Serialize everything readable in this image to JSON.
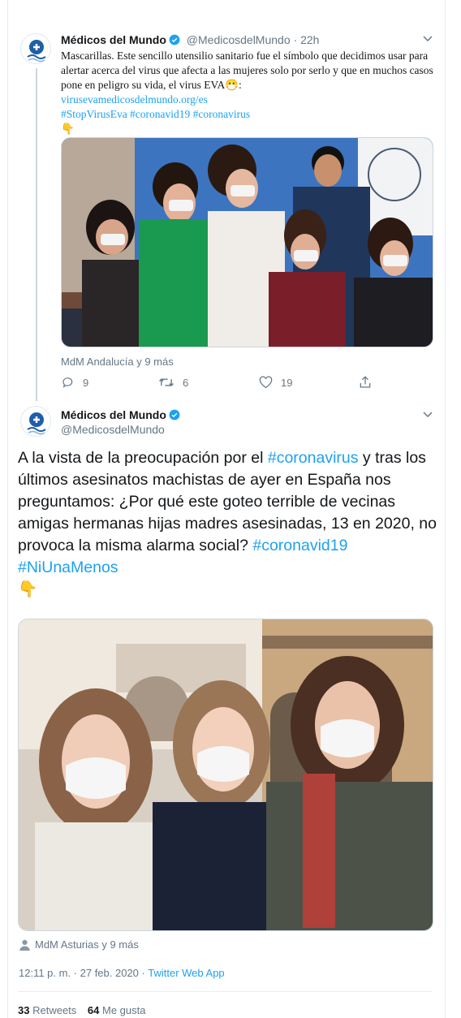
{
  "tweet1": {
    "author": "Médicos del Mundo",
    "handle": "@MedicosdelMundo",
    "time": "22h",
    "text": "Mascarillas. Este sencillo utensilio sanitario fue el símbolo que decidimos usar para alertar acerca del virus que afecta a las mujeres solo por serlo y que en muchos casos pone en peligro su vida, el virus EVA😷:",
    "link": "virusevamedicosdelmundo.org/es",
    "hashtags": "#StopVirusEva #coronavid19 #coronavirus",
    "emoji": "👇",
    "tagged": "MdM Andalucía y 9 más",
    "replies": "9",
    "retweets": "6",
    "likes": "19"
  },
  "tweet2": {
    "author": "Médicos del Mundo",
    "handle": "@MedicosdelMundo",
    "text_part1": "A la vista de la preocupación por el ",
    "hashtag1": "#coronavirus",
    "text_part2": " y tras los últimos asesinatos machistas de ayer en España nos preguntamos: ¿Por qué este goteo terrible de vecinas amigas hermanas hijas madres asesinadas, 13 en 2020, no provoca la misma alarma social? ",
    "hashtag2": "#coronavid19",
    "hashtag3": "#NiUnaMenos",
    "emoji": "👇",
    "tagged": "MdM Asturias y 9 más",
    "timestamp": "12:11 p. m. · 27 feb. 2020 · ",
    "source": "Twitter Web App",
    "retweet_count": "33",
    "retweet_label": "Retweets",
    "like_count": "64",
    "like_label": "Me gusta"
  },
  "colors": {
    "accent": "#1da1f2",
    "muted": "#657786",
    "text": "#14171a"
  }
}
